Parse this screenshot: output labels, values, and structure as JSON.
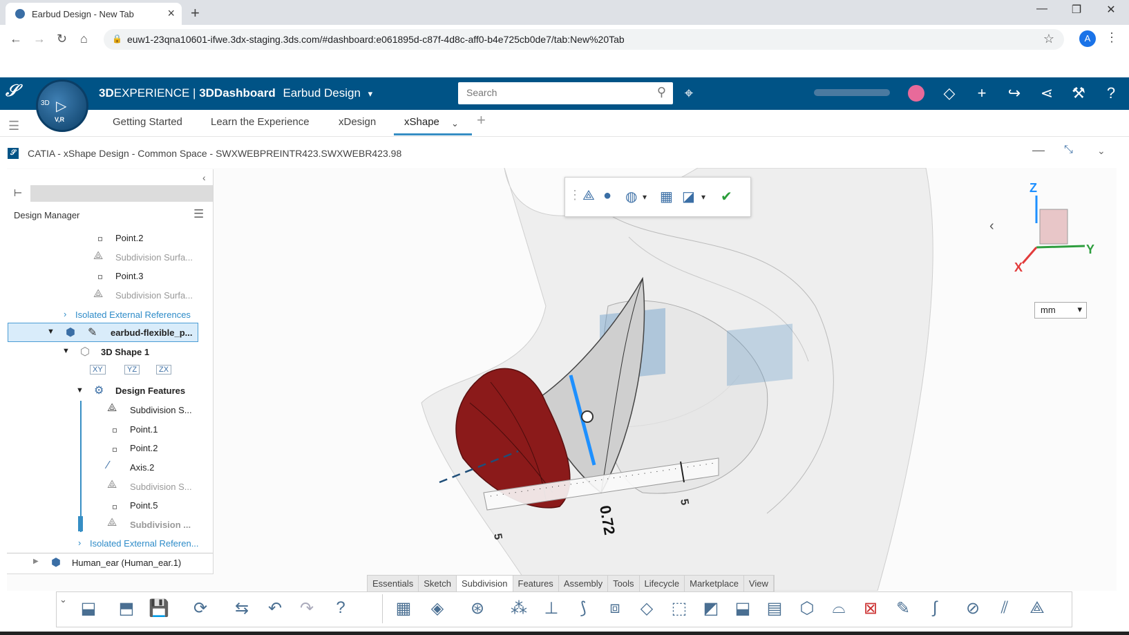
{
  "browser": {
    "tab_title": "Earbud Design - New Tab",
    "new_tab": "+",
    "win_min": "—",
    "win_restore": "❐",
    "win_close": "✕",
    "url": "euw1-23qna10601-ifwe.3dx-staging.3ds.com/#dashboard:e061895d-c87f-4d8c-aff0-b4e725cb0de7/tab:New%20Tab",
    "profile": "A"
  },
  "topbar": {
    "brand_3d": "3D",
    "brand_exp": "EXPERIENCE",
    "brand_sep": " | ",
    "brand_dash": "3DDashboard",
    "dashboard_name": "Earbud Design",
    "compass_label_top": "3D",
    "compass_label_bottom": "V,R",
    "search_placeholder": "Search"
  },
  "tabs": [
    "Getting Started",
    "Learn the Experience",
    "xDesign",
    "xShape"
  ],
  "app": {
    "title": "CATIA - xShape Design - Common Space - SWXWEBPREINTR423.SWXWEBR423.98"
  },
  "tree": {
    "panel_title": "Design Manager",
    "nodes": {
      "n1": "Point.2",
      "n2": "Subdivision Surfa...",
      "n3": "Point.3",
      "n4": "Subdivision Surfa...",
      "n5": "Isolated External References",
      "n6": "earbud-flexible_p...",
      "n7": "3D Shape 1",
      "n8": "Design Features",
      "n9": "Subdivision S...",
      "n10": "Point.1",
      "n11": "Point.2",
      "n12": "Axis.2",
      "n13": "Subdivision S...",
      "n14": "Point.5",
      "n15": "Subdivision ...",
      "n16": "Isolated External Referen...",
      "n17": "Human_ear (Human_ear.1)"
    },
    "planes": [
      "XY",
      "YZ",
      "ZX"
    ]
  },
  "viewport": {
    "unit": "mm",
    "axis_z": "Z",
    "axis_y": "Y",
    "axis_x": "X",
    "dim_value": "0.72",
    "ruler_5a": "5",
    "ruler_5b": "5"
  },
  "command_tabs": [
    "Essentials",
    "Sketch",
    "Subdivision",
    "Features",
    "Assembly",
    "Tools",
    "Lifecycle",
    "Marketplace",
    "View"
  ],
  "colors": {
    "brand": "#005386",
    "accent": "#368ec4",
    "earbud": "#8b1a1a"
  }
}
